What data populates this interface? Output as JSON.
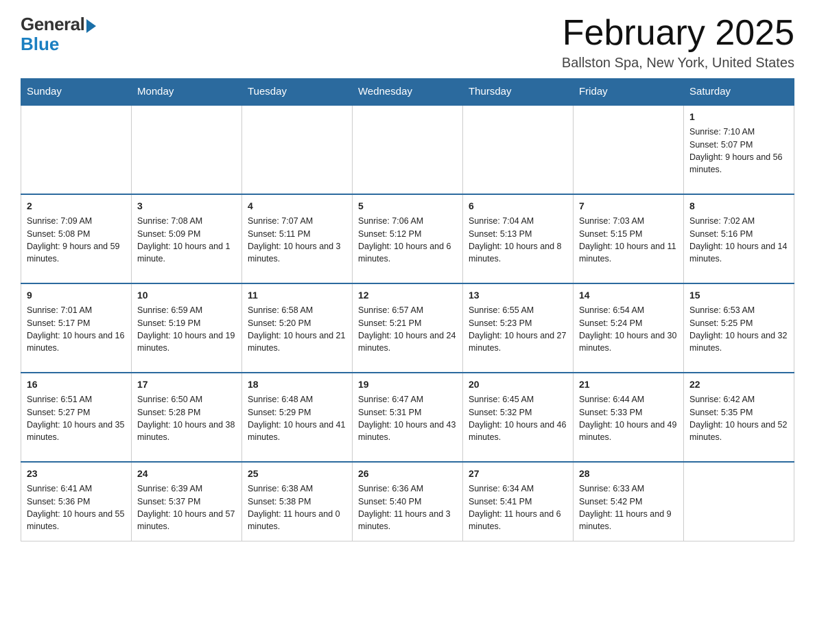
{
  "logo": {
    "general": "General",
    "blue": "Blue"
  },
  "title": "February 2025",
  "location": "Ballston Spa, New York, United States",
  "days_of_week": [
    "Sunday",
    "Monday",
    "Tuesday",
    "Wednesday",
    "Thursday",
    "Friday",
    "Saturday"
  ],
  "weeks": [
    [
      {
        "day": "",
        "info": ""
      },
      {
        "day": "",
        "info": ""
      },
      {
        "day": "",
        "info": ""
      },
      {
        "day": "",
        "info": ""
      },
      {
        "day": "",
        "info": ""
      },
      {
        "day": "",
        "info": ""
      },
      {
        "day": "1",
        "info": "Sunrise: 7:10 AM\nSunset: 5:07 PM\nDaylight: 9 hours and 56 minutes."
      }
    ],
    [
      {
        "day": "2",
        "info": "Sunrise: 7:09 AM\nSunset: 5:08 PM\nDaylight: 9 hours and 59 minutes."
      },
      {
        "day": "3",
        "info": "Sunrise: 7:08 AM\nSunset: 5:09 PM\nDaylight: 10 hours and 1 minute."
      },
      {
        "day": "4",
        "info": "Sunrise: 7:07 AM\nSunset: 5:11 PM\nDaylight: 10 hours and 3 minutes."
      },
      {
        "day": "5",
        "info": "Sunrise: 7:06 AM\nSunset: 5:12 PM\nDaylight: 10 hours and 6 minutes."
      },
      {
        "day": "6",
        "info": "Sunrise: 7:04 AM\nSunset: 5:13 PM\nDaylight: 10 hours and 8 minutes."
      },
      {
        "day": "7",
        "info": "Sunrise: 7:03 AM\nSunset: 5:15 PM\nDaylight: 10 hours and 11 minutes."
      },
      {
        "day": "8",
        "info": "Sunrise: 7:02 AM\nSunset: 5:16 PM\nDaylight: 10 hours and 14 minutes."
      }
    ],
    [
      {
        "day": "9",
        "info": "Sunrise: 7:01 AM\nSunset: 5:17 PM\nDaylight: 10 hours and 16 minutes."
      },
      {
        "day": "10",
        "info": "Sunrise: 6:59 AM\nSunset: 5:19 PM\nDaylight: 10 hours and 19 minutes."
      },
      {
        "day": "11",
        "info": "Sunrise: 6:58 AM\nSunset: 5:20 PM\nDaylight: 10 hours and 21 minutes."
      },
      {
        "day": "12",
        "info": "Sunrise: 6:57 AM\nSunset: 5:21 PM\nDaylight: 10 hours and 24 minutes."
      },
      {
        "day": "13",
        "info": "Sunrise: 6:55 AM\nSunset: 5:23 PM\nDaylight: 10 hours and 27 minutes."
      },
      {
        "day": "14",
        "info": "Sunrise: 6:54 AM\nSunset: 5:24 PM\nDaylight: 10 hours and 30 minutes."
      },
      {
        "day": "15",
        "info": "Sunrise: 6:53 AM\nSunset: 5:25 PM\nDaylight: 10 hours and 32 minutes."
      }
    ],
    [
      {
        "day": "16",
        "info": "Sunrise: 6:51 AM\nSunset: 5:27 PM\nDaylight: 10 hours and 35 minutes."
      },
      {
        "day": "17",
        "info": "Sunrise: 6:50 AM\nSunset: 5:28 PM\nDaylight: 10 hours and 38 minutes."
      },
      {
        "day": "18",
        "info": "Sunrise: 6:48 AM\nSunset: 5:29 PM\nDaylight: 10 hours and 41 minutes."
      },
      {
        "day": "19",
        "info": "Sunrise: 6:47 AM\nSunset: 5:31 PM\nDaylight: 10 hours and 43 minutes."
      },
      {
        "day": "20",
        "info": "Sunrise: 6:45 AM\nSunset: 5:32 PM\nDaylight: 10 hours and 46 minutes."
      },
      {
        "day": "21",
        "info": "Sunrise: 6:44 AM\nSunset: 5:33 PM\nDaylight: 10 hours and 49 minutes."
      },
      {
        "day": "22",
        "info": "Sunrise: 6:42 AM\nSunset: 5:35 PM\nDaylight: 10 hours and 52 minutes."
      }
    ],
    [
      {
        "day": "23",
        "info": "Sunrise: 6:41 AM\nSunset: 5:36 PM\nDaylight: 10 hours and 55 minutes."
      },
      {
        "day": "24",
        "info": "Sunrise: 6:39 AM\nSunset: 5:37 PM\nDaylight: 10 hours and 57 minutes."
      },
      {
        "day": "25",
        "info": "Sunrise: 6:38 AM\nSunset: 5:38 PM\nDaylight: 11 hours and 0 minutes."
      },
      {
        "day": "26",
        "info": "Sunrise: 6:36 AM\nSunset: 5:40 PM\nDaylight: 11 hours and 3 minutes."
      },
      {
        "day": "27",
        "info": "Sunrise: 6:34 AM\nSunset: 5:41 PM\nDaylight: 11 hours and 6 minutes."
      },
      {
        "day": "28",
        "info": "Sunrise: 6:33 AM\nSunset: 5:42 PM\nDaylight: 11 hours and 9 minutes."
      },
      {
        "day": "",
        "info": ""
      }
    ]
  ]
}
